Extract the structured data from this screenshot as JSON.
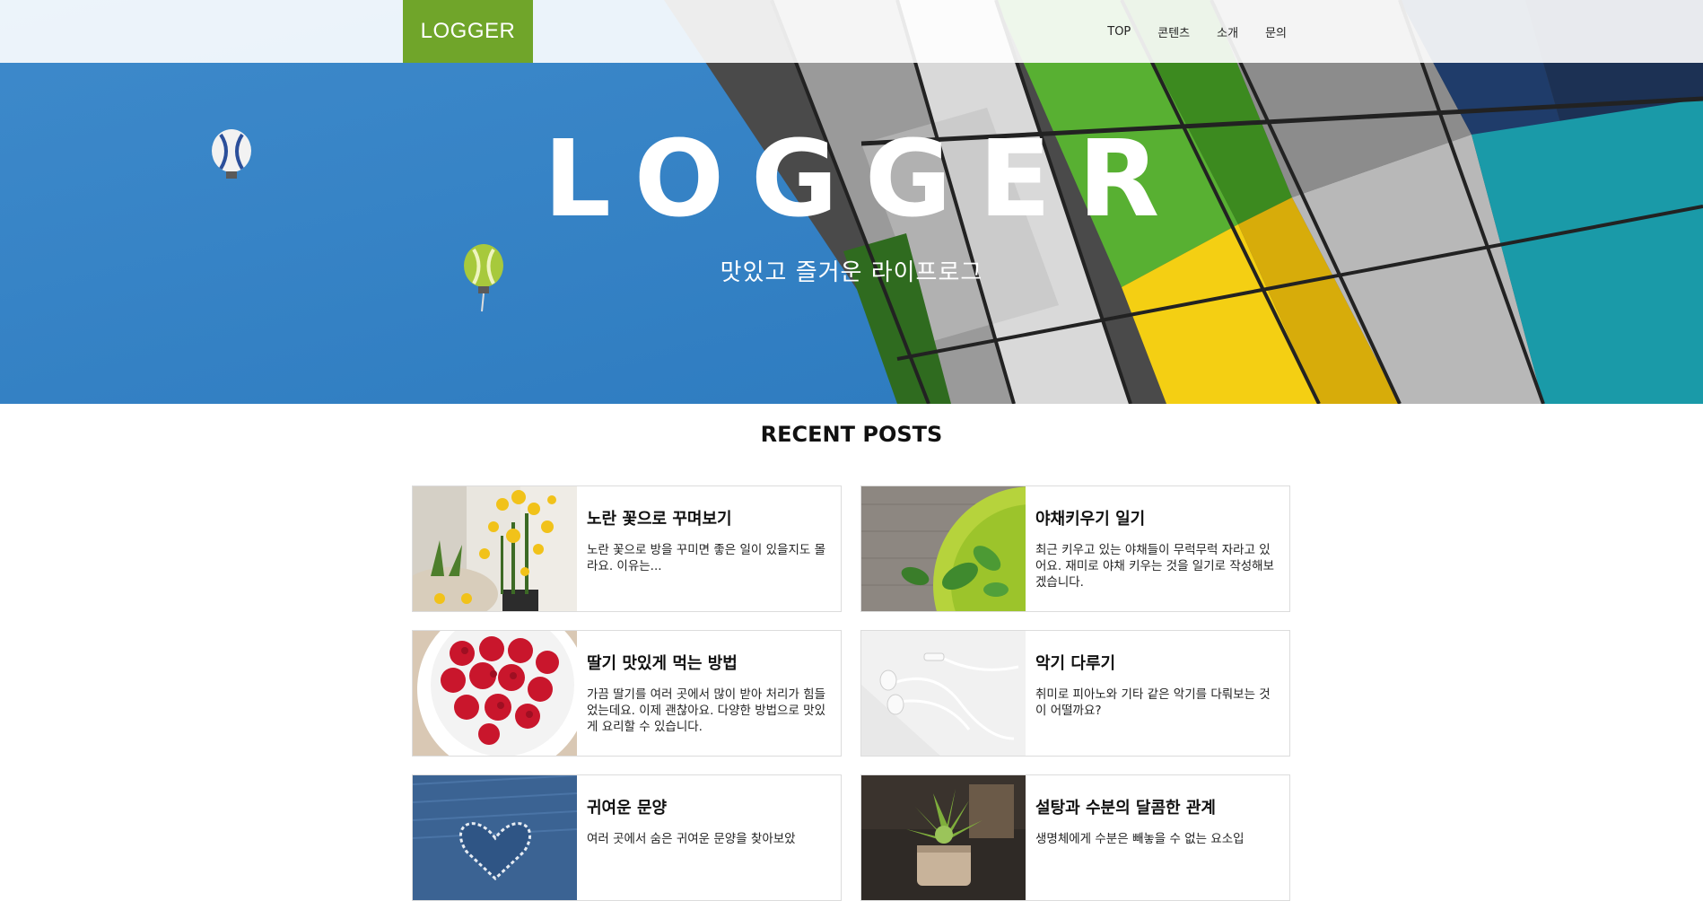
{
  "header": {
    "logo": "LOGGER",
    "nav": [
      "TOP",
      "콘텐츠",
      "소개",
      "문의"
    ]
  },
  "hero": {
    "title": "LOGGER",
    "subtitle": "맛있고 즐거운 라이프로그"
  },
  "recent": {
    "heading": "RECENT POSTS",
    "posts": [
      {
        "title": "노란 꽃으로 꾸며보기",
        "text": "노란 꽃으로 방을 꾸미면 좋은 일이 있을지도 몰라요. 이유는...",
        "image": "yellow-flowers"
      },
      {
        "title": "야채키우기 일기",
        "text": "최근 키우고 있는 야채들이 무럭무럭 자라고 있어요. 재미로 야채 키우는 것을 일기로 작성해보겠습니다.",
        "image": "basil-plate"
      },
      {
        "title": "딸기 맛있게 먹는 방법",
        "text": "가끔 딸기를 여러 곳에서 많이 받아 처리가 힘들었는데요. 이제 괜찮아요. 다양한 방법으로 맛있게 요리할 수 있습니다.",
        "image": "raspberries-bowl"
      },
      {
        "title": "악기 다루기",
        "text": "취미로 피아노와 기타 같은 악기를 다뤄보는 것이 어떨까요?",
        "image": "earphones"
      },
      {
        "title": "귀여운 문양",
        "text": "여러 곳에서 숨은 귀여운 문양을 찾아보았",
        "image": "denim-heart"
      },
      {
        "title": "설탕과 수분의 달콤한 관계",
        "text": "생명체에게 수분은 빼놓을 수 없는 요소입",
        "image": "succulent"
      }
    ]
  },
  "colors": {
    "accent": "#70a52a",
    "sky": "#2e7fc4"
  }
}
